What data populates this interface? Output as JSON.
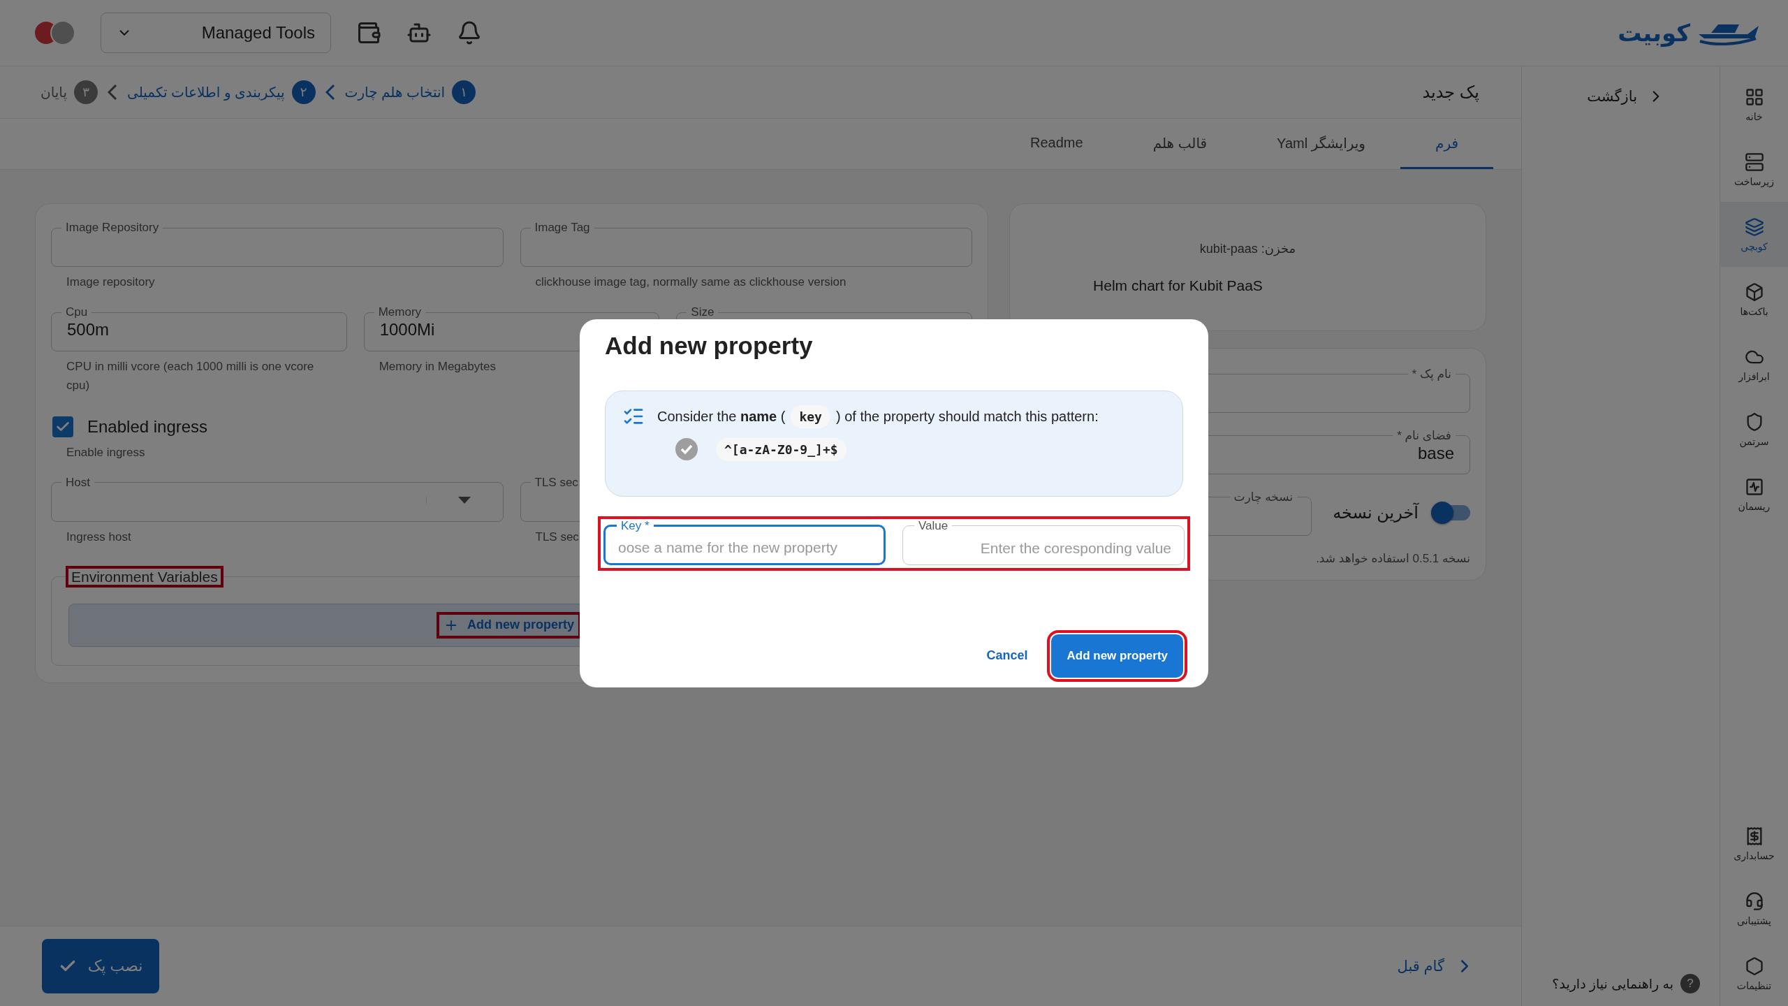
{
  "header": {
    "logo": "کوبیت",
    "workspace_select": "Managed Tools"
  },
  "sidebar": {
    "items": [
      {
        "label": "خانه",
        "selected": false
      },
      {
        "label": "زیرساخت",
        "selected": false
      },
      {
        "label": "کوبچی",
        "selected": true
      },
      {
        "label": "باکت‌ها",
        "selected": false
      },
      {
        "label": "ابرافزار",
        "selected": false
      },
      {
        "label": "سرتمن",
        "selected": false
      },
      {
        "label": "ریسمان",
        "selected": false
      }
    ],
    "bottom_items": [
      {
        "label": "حسابداری",
        "selected": false
      },
      {
        "label": "پشتیبانی",
        "selected": false
      },
      {
        "label": "تنظیمات",
        "selected": false
      }
    ]
  },
  "nav_panel": {
    "back": "بازگشت",
    "help": "به راهنمایی نیاز دارید؟",
    "help_icon": "?"
  },
  "page": {
    "title": "پک جدید",
    "steps": [
      {
        "number": "۱",
        "label": "انتخاب هلم چارت",
        "active": true
      },
      {
        "number": "۲",
        "label": "پیکربندی و اطلاعات تکمیلی",
        "active": true
      },
      {
        "number": "۳",
        "label": "پایان",
        "active": false
      }
    ],
    "tabs": [
      {
        "label": "فرم",
        "selected": true
      },
      {
        "label": "ویرایشگر Yaml",
        "selected": false
      },
      {
        "label": "قالب هلم",
        "selected": false
      },
      {
        "label": "Readme",
        "selected": false
      }
    ]
  },
  "form": {
    "rows": [
      {
        "kind": "fields",
        "fields": [
          {
            "label": "Image Tag",
            "helper": "clickhouse image tag, normally same as clickhouse version"
          },
          {
            "label": "Image Repository",
            "helper": "Image repository"
          }
        ]
      },
      {
        "kind": "fields",
        "fields": [
          {
            "label": "Size"
          },
          {
            "label": "Memory",
            "value": "1000Mi",
            "helper": "Memory in Megabytes"
          },
          {
            "label": "Cpu",
            "value": "500m",
            "helper": "CPU in milli vcore (each 1000 milli is one vcore cpu)"
          }
        ]
      },
      {
        "kind": "checkbox",
        "label": "Enabled ingress",
        "checked": true,
        "helper": "Enable ingress"
      },
      {
        "kind": "fields",
        "fields": [
          {
            "label": "TLS sec",
            "helper": "TLS sec"
          },
          {
            "label": "Host",
            "helper": "Ingress host",
            "select": true
          }
        ]
      },
      {
        "kind": "section",
        "legend": "Environment Variables",
        "highlighted": true,
        "button": {
          "label": "Add new property",
          "highlighted": true
        }
      }
    ]
  },
  "repo_card": {
    "repo_label": "مخزن:",
    "repo_value": "kubit-paas",
    "description": "Helm chart for Kubit PaaS"
  },
  "pack_card": {
    "name_field": {
      "label": "نام پک *"
    },
    "namespace_field": {
      "label": "فضای نام *",
      "value": "base"
    },
    "version_field": {
      "label": "نسخه چارت"
    },
    "latest_toggle": {
      "label": "آخرین نسخه",
      "on": true
    },
    "note": "نسخه 0.5.1 استفاده خواهد شد."
  },
  "footer": {
    "install": "نصب پک",
    "previous": "گام قبل"
  },
  "dialog": {
    "title": "Add new property",
    "hint_before": "Consider the **name** (",
    "hint_code": "key",
    "hint_after": ") of the property should match this pattern:",
    "pattern": "^[a-zA-Z0-9_]+$",
    "pattern_valid": false,
    "fields_highlighted": true,
    "key_field": {
      "label": "Key *",
      "placeholder": "oose a name for the new property",
      "focused": true
    },
    "value_field": {
      "label": "Value",
      "placeholder": "Enter the coresponding value",
      "focused": false
    },
    "cancel": "Cancel",
    "submit": {
      "label": "Add new property",
      "highlighted": true
    }
  }
}
